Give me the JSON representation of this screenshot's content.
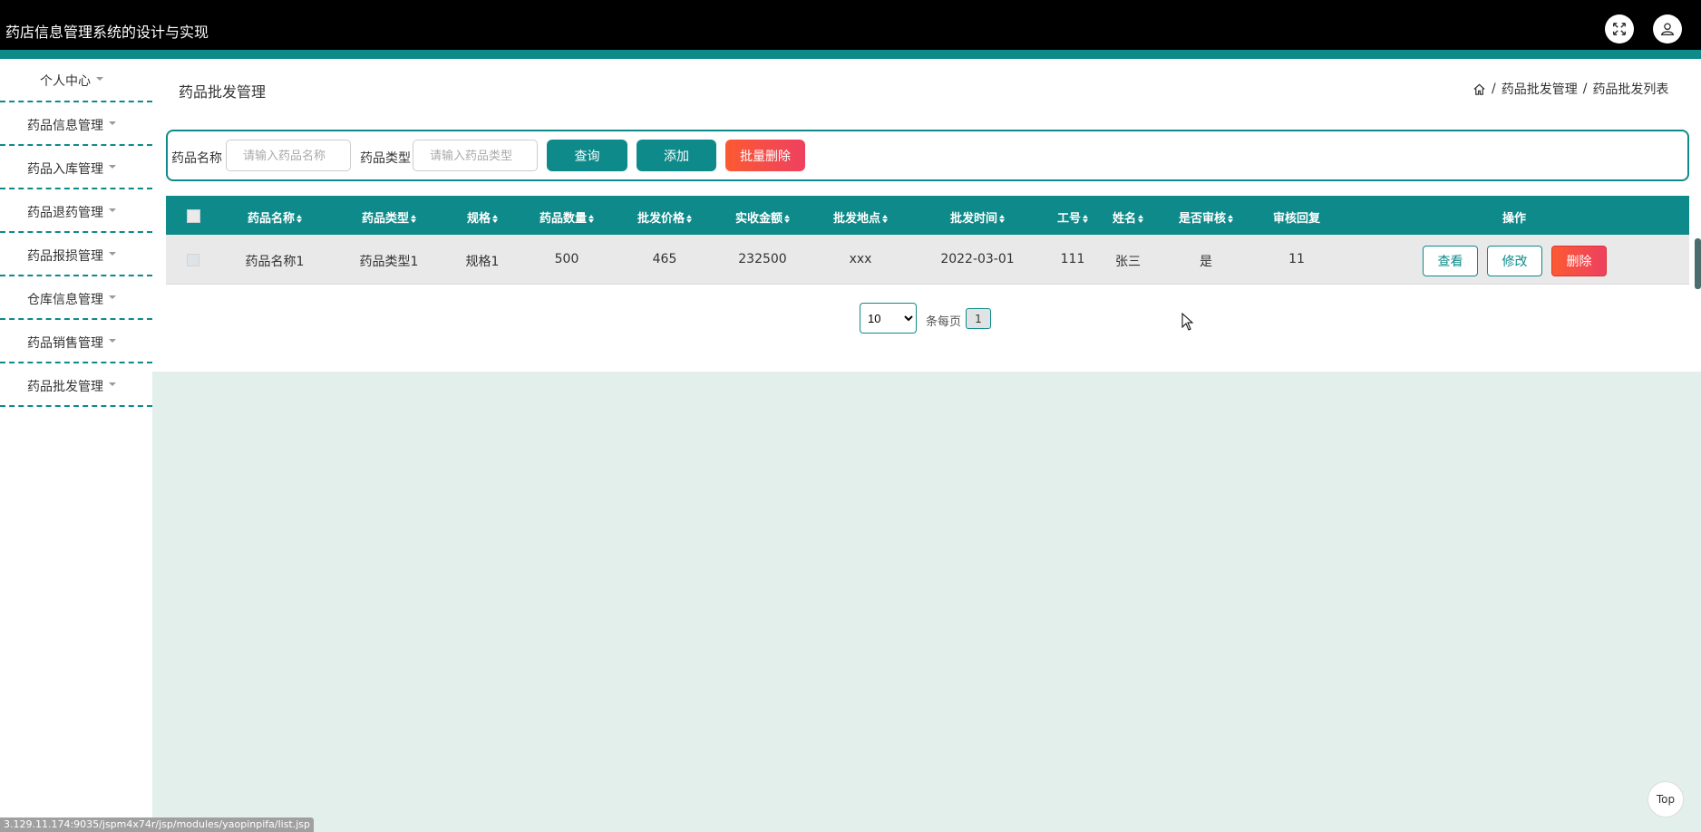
{
  "header": {
    "app_title": "药店信息管理系统的设计与实现",
    "fullscreen_icon": "expand-icon",
    "user_icon": "user-icon"
  },
  "sidebar": {
    "items": [
      {
        "label": "个人中心"
      },
      {
        "label": "药品信息管理"
      },
      {
        "label": "药品入库管理"
      },
      {
        "label": "药品退药管理"
      },
      {
        "label": "药品报损管理"
      },
      {
        "label": "仓库信息管理"
      },
      {
        "label": "药品销售管理"
      },
      {
        "label": "药品批发管理"
      }
    ]
  },
  "page": {
    "title": "药品批发管理",
    "breadcrumb": [
      "药品批发管理",
      "药品批发列表"
    ],
    "breadcrumb_sep": "/"
  },
  "search": {
    "name_label": "药品名称",
    "name_placeholder": "请输入药品名称",
    "type_label": "药品类型",
    "type_placeholder": "请输入药品类型",
    "query_button": "查询",
    "add_button": "添加",
    "batch_delete_button": "批量删除"
  },
  "table": {
    "columns": [
      "药品名称",
      "药品类型",
      "规格",
      "药品数量",
      "批发价格",
      "实收金额",
      "批发地点",
      "批发时间",
      "工号",
      "姓名",
      "是否审核",
      "审核回复",
      "操作"
    ],
    "rows": [
      {
        "name": "药品名称1",
        "type": "药品类型1",
        "spec": "规格1",
        "quantity": "500",
        "price": "465",
        "amount": "232500",
        "location": "xxx",
        "time": "2022-03-01",
        "job_no": "111",
        "person": "张三",
        "reviewed": "是",
        "reply": "11",
        "view": "查看",
        "edit": "修改",
        "delete": "删除"
      }
    ]
  },
  "pagination": {
    "page_size": "10",
    "per_page_label": "条每页",
    "current_page": "1"
  },
  "top_button": "Top",
  "status_url": "3.129.11.174:9035/jspm4x74r/jsp/modules/yaopinpifa/list.jsp",
  "colors": {
    "accent": "#0f8a8a",
    "danger": "#f2474f",
    "background": "#e3efeb"
  }
}
